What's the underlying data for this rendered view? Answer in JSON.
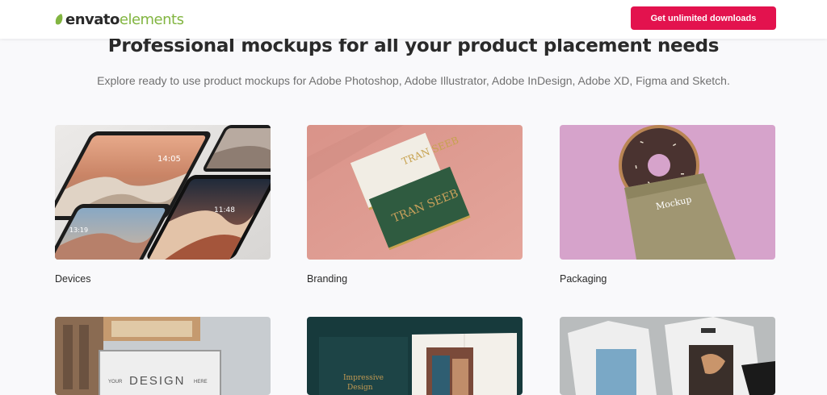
{
  "header": {
    "logo_brand": "envato",
    "logo_product": "elements",
    "cta_label": "Get unlimited downloads",
    "brand_color": "#e3124e",
    "logo_accent": "#82b541"
  },
  "hero": {
    "title": "Professional mockups for all your product placement needs",
    "subtitle": "Explore ready to use product mockups for Adobe Photoshop, Adobe Illustrator, Adobe InDesign, Adobe XD, Figma and Sketch."
  },
  "categories": [
    {
      "label": "Devices",
      "screen_time_1": "14:05",
      "screen_time_2": "11:48",
      "screen_time_3": "13:19"
    },
    {
      "label": "Branding",
      "card_text": "TRAN SEEB"
    },
    {
      "label": "Packaging",
      "bag_text": "Mockup"
    },
    {
      "label": "",
      "sign_text_small_1": "YOUR",
      "sign_text_big": "DESIGN",
      "sign_text_small_2": "HERE"
    },
    {
      "label": "",
      "book_title_1": "Impressive",
      "book_title_2": "Design"
    },
    {
      "label": ""
    }
  ]
}
